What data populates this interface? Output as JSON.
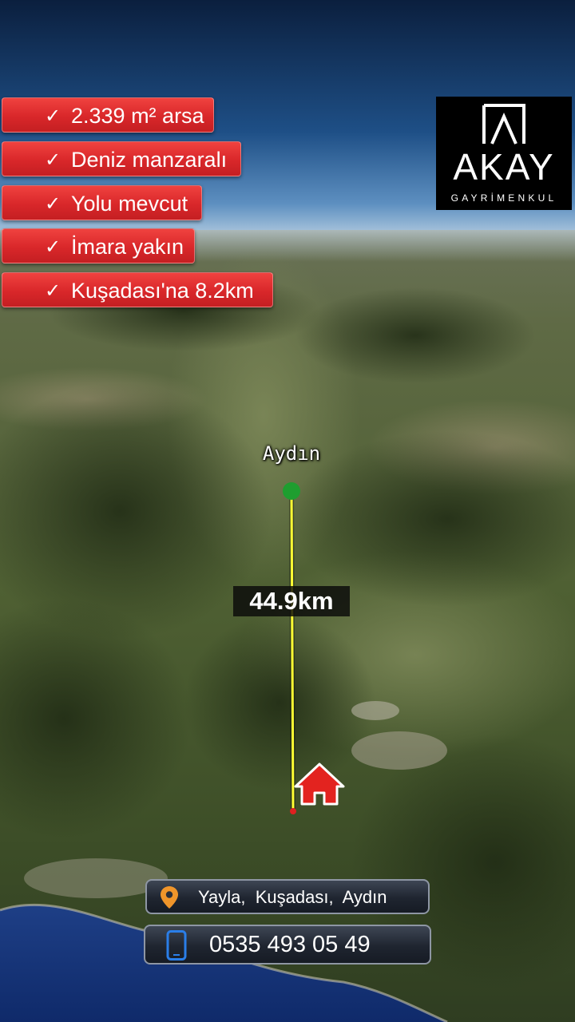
{
  "features": [
    "2.339 m² arsa",
    "Deniz manzaralı",
    "Yolu mevcut",
    "İmara yakın",
    "Kuşadası'na 8.2km"
  ],
  "check_symbol": "✓",
  "logo": {
    "name": "AKAY",
    "subtitle": "GAYRİMENKUL"
  },
  "map": {
    "city_label": "Aydın",
    "distance": "44.9km",
    "route_color": "#ffff33",
    "start_marker_color": "#1e9e2f",
    "destination_icon": "home-icon"
  },
  "location": {
    "icon": "map-pin-icon",
    "text": "Yayla,  Kuşadası,  Aydın"
  },
  "contact": {
    "icon": "phone-icon",
    "phone": "0535 493 05 49"
  },
  "colors": {
    "badge": "#d9272a",
    "info_bar": "#1f2530",
    "pin": "#f0952a",
    "phone_icon": "#2a7ee8"
  }
}
